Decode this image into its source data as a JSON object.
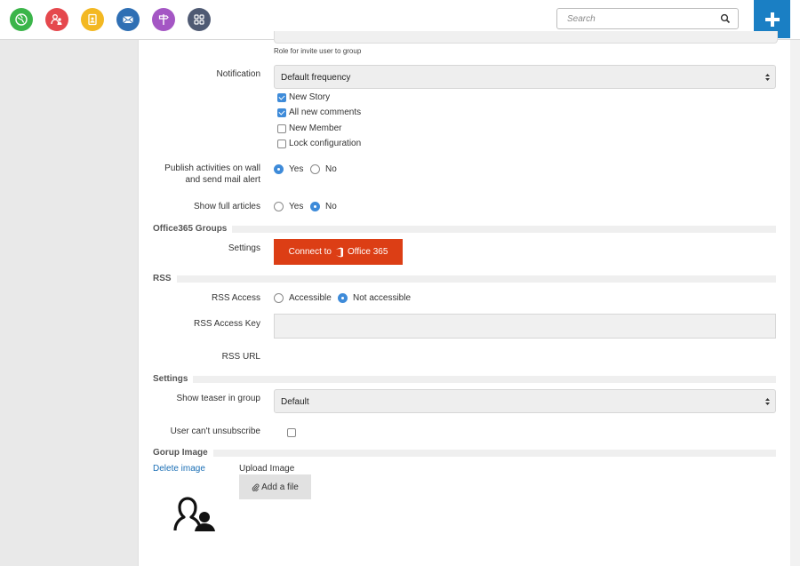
{
  "topbar": {
    "apps": [
      {
        "name": "globe-icon",
        "color": "#3bb54a"
      },
      {
        "name": "people-icon",
        "color": "#e5484d"
      },
      {
        "name": "address-book-icon",
        "color": "#f3b822"
      },
      {
        "name": "mail-icon",
        "color": "#2f6fb4"
      },
      {
        "name": "signpost-icon",
        "color": "#a456c4"
      },
      {
        "name": "grid-icon",
        "color": "#4f5a73"
      }
    ],
    "search_placeholder": "Search",
    "add_button_color": "#1a7fc4"
  },
  "form": {
    "role_help": "Role for invite user to group",
    "notification": {
      "label": "Notification",
      "value": "Default frequency",
      "checkboxes": [
        {
          "label": "New Story",
          "checked": true
        },
        {
          "label": "All new comments",
          "checked": true
        },
        {
          "label": "New Member",
          "checked": false
        },
        {
          "label": "Lock configuration",
          "checked": false
        }
      ]
    },
    "publish": {
      "label_line1": "Publish activities on wall",
      "label_line2": "and send mail alert",
      "yes": "Yes",
      "no": "No",
      "selected": "yes"
    },
    "full_articles": {
      "label": "Show full articles",
      "yes": "Yes",
      "no": "No",
      "selected": "no"
    }
  },
  "office365": {
    "heading": "Office365 Groups",
    "settings_label": "Settings",
    "button_prefix": "Connect to",
    "button_brand": "Office 365",
    "button_color": "#dc3e15"
  },
  "rss": {
    "heading": "RSS",
    "access_label": "RSS Access",
    "accessible": "Accessible",
    "not_accessible": "Not accessible",
    "selected": "not_accessible",
    "key_label": "RSS Access Key",
    "key_value": "",
    "url_label": "RSS URL"
  },
  "settings": {
    "heading": "Settings",
    "teaser_label": "Show teaser in group",
    "teaser_value": "Default",
    "unsubscribe_label": "User can't unsubscribe",
    "unsubscribe_checked": false
  },
  "image": {
    "heading": "Gorup Image",
    "delete_link": "Delete image",
    "upload_label": "Upload Image",
    "add_file": "Add a file",
    "placeholder_icon": "group-avatar-icon"
  },
  "colors": {
    "accent": "#3e8bd9",
    "link": "#1b6fb5"
  }
}
